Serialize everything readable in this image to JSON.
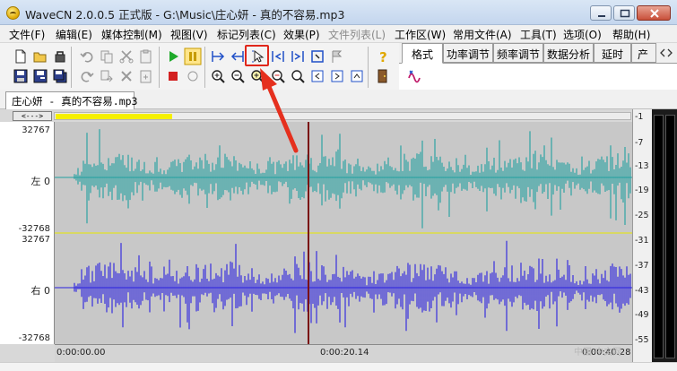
{
  "window": {
    "title": "WaveCN 2.0.0.5 正式版 - G:\\Music\\庄心妍 - 真的不容易.mp3"
  },
  "menu": [
    {
      "label": "文件(F)",
      "disabled": false
    },
    {
      "label": "编辑(E)",
      "disabled": false
    },
    {
      "label": "媒体控制(M)",
      "disabled": false
    },
    {
      "label": "视图(V)",
      "disabled": false
    },
    {
      "label": "标记列表(C)",
      "disabled": false
    },
    {
      "label": "效果(P)",
      "disabled": false
    },
    {
      "label": "文件列表(L)",
      "disabled": true
    },
    {
      "label": "工作区(W)",
      "disabled": false
    },
    {
      "label": "常用文件(A)",
      "disabled": false
    },
    {
      "label": "工具(T)",
      "disabled": false
    },
    {
      "label": "选项(O)",
      "disabled": false
    },
    {
      "label": "帮助(H)",
      "disabled": false
    }
  ],
  "right_tabs": [
    "格式",
    "功率调节",
    "频率调节",
    "数据分析",
    "延时",
    "产"
  ],
  "active_right_tab": "格式",
  "document_tab": "庄心妍 - 真的不容易.mp3",
  "scroll_head_label": "<--->",
  "waveform": {
    "left_channel": {
      "label": "左 0",
      "max": "32767",
      "min": "-32768",
      "color": "#20a0a0"
    },
    "right_channel": {
      "label": "右 0",
      "max": "32767",
      "min": "-32768",
      "color": "#2a20e0"
    },
    "cursor_color": "#7a1010",
    "divider_color": "#e8e800"
  },
  "time_axis": {
    "start": "0:00:00.00",
    "mid": "0:00:20.14",
    "end": "0:00:40.28"
  },
  "db_scale": [
    "-1",
    "-7",
    "-13",
    "-19",
    "-25",
    "-31",
    "-37",
    "-43",
    "-49",
    "-55"
  ],
  "watermark": "中国·中文网"
}
